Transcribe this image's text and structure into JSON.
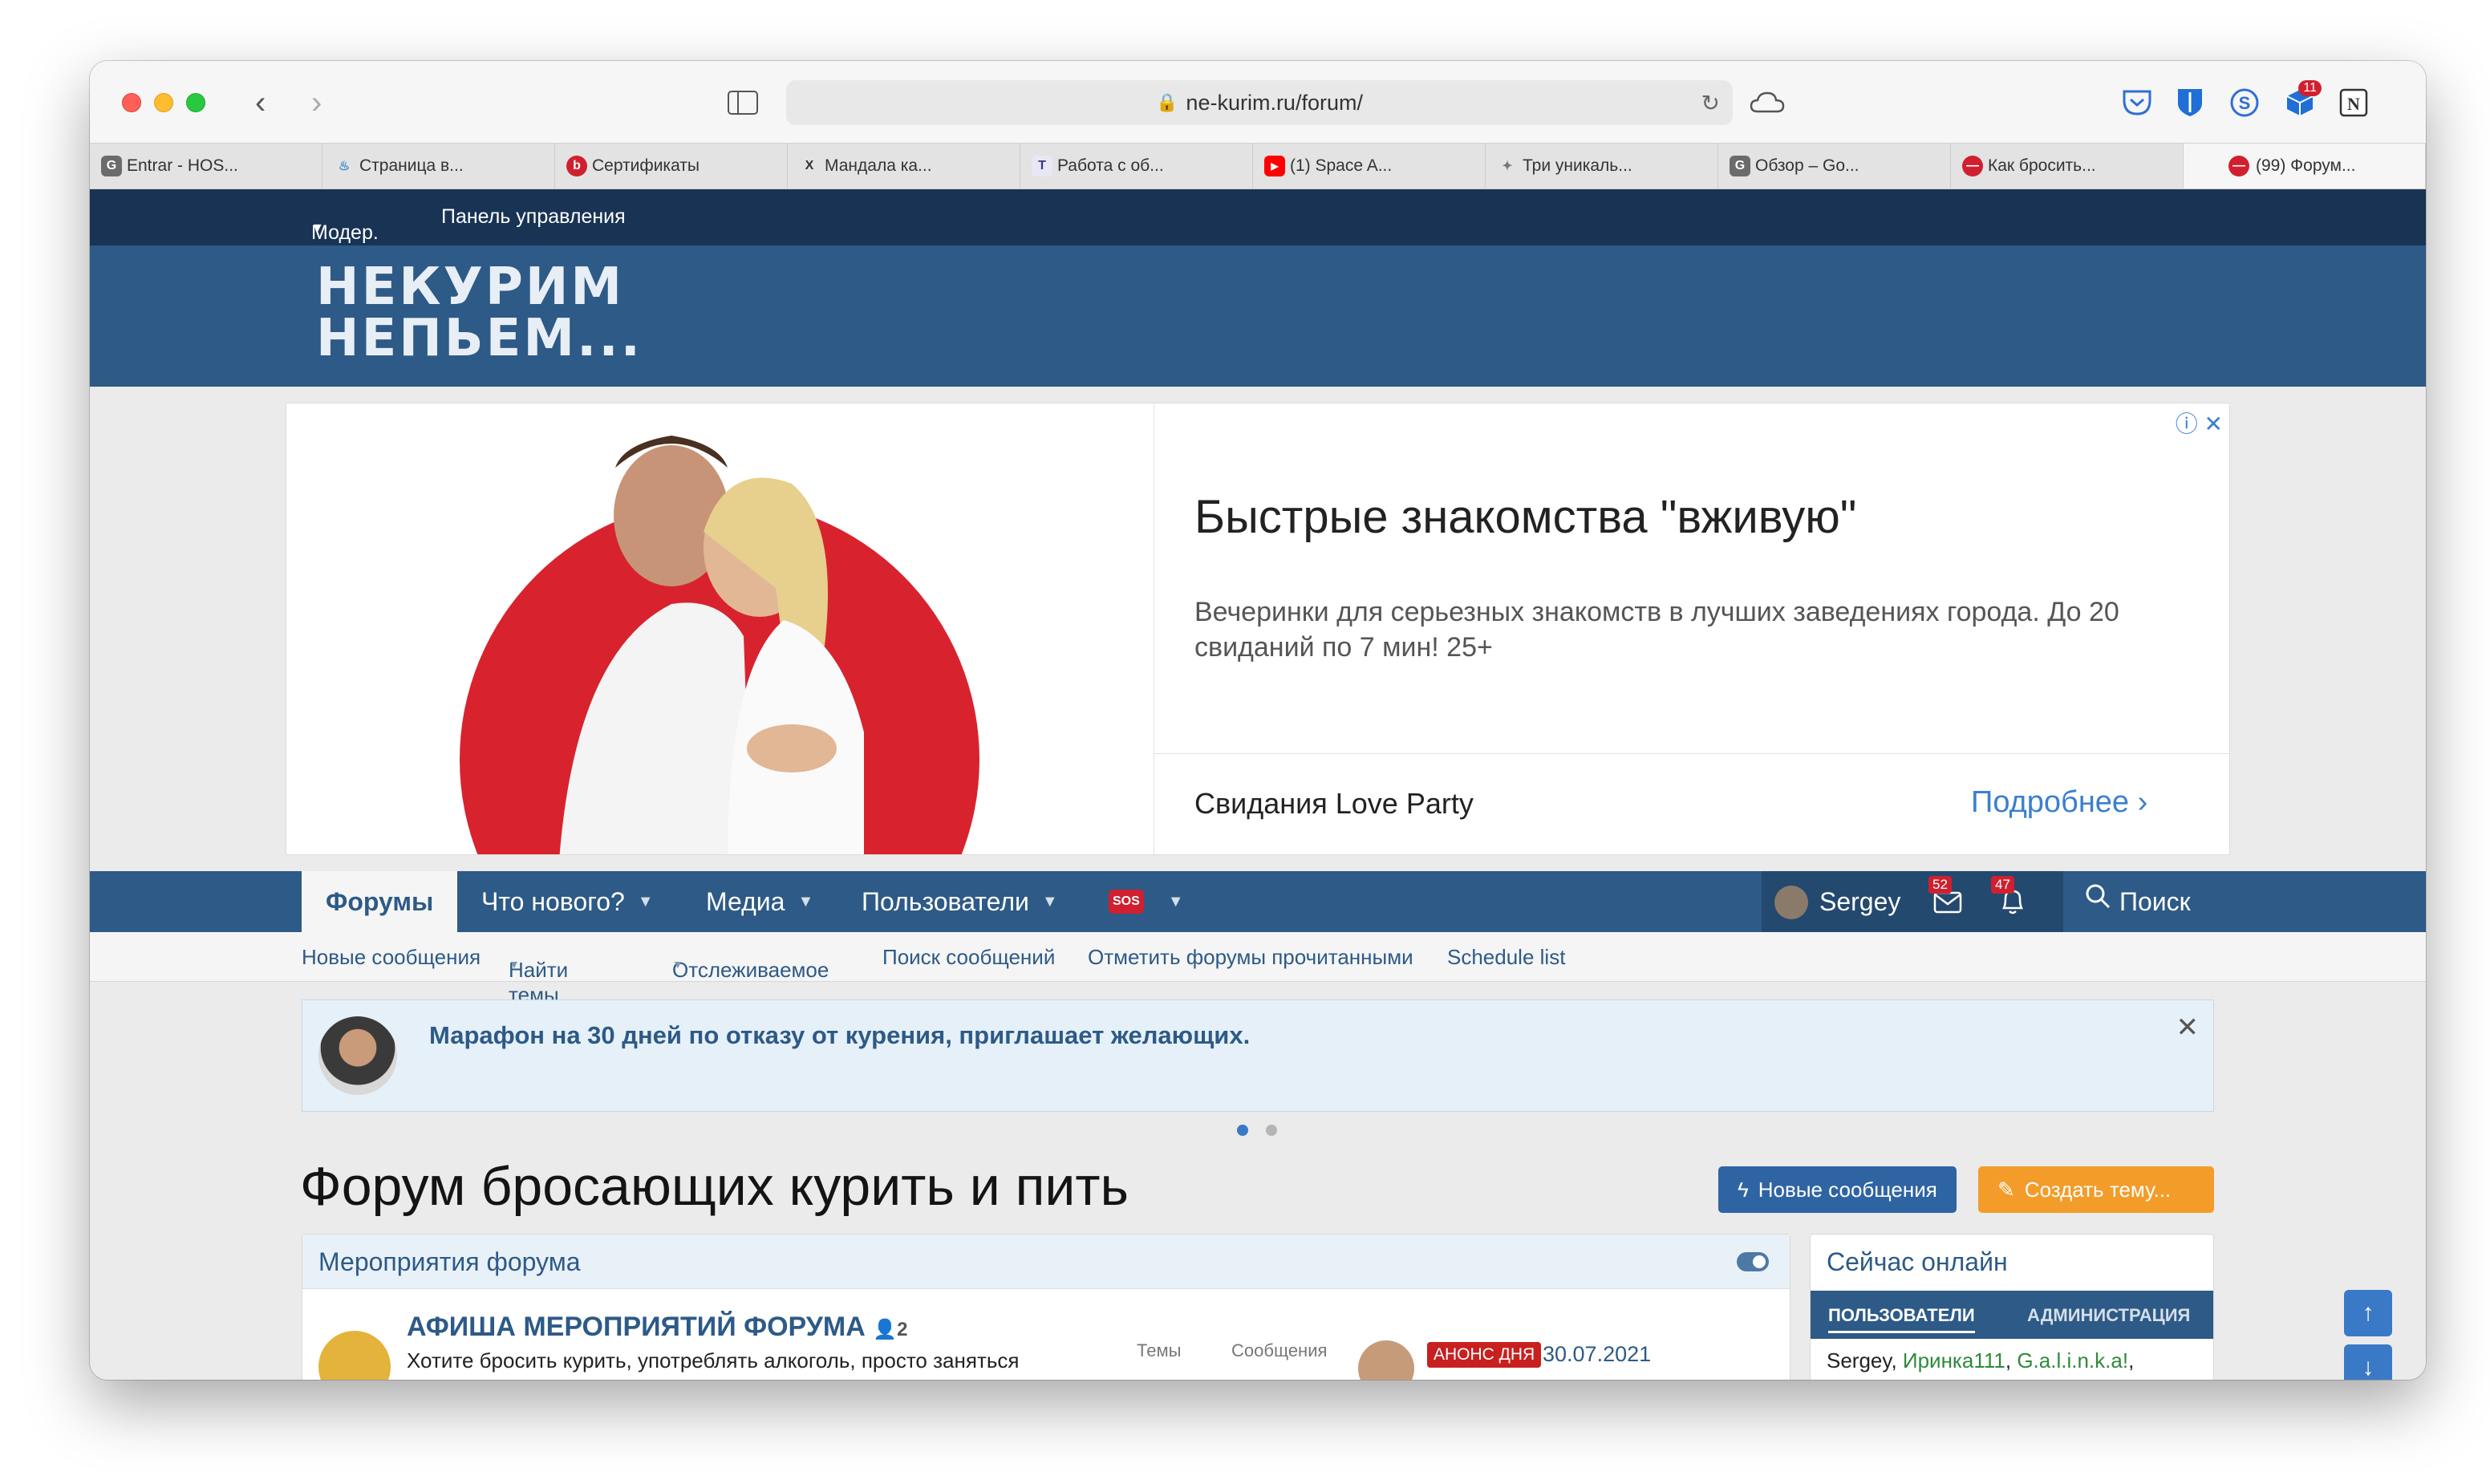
{
  "browser": {
    "url": "ne-kurim.ru/forum/",
    "tabs": [
      {
        "label": "Entrar - HOS...",
        "color": "#6b6b6b",
        "glyph": "G"
      },
      {
        "label": "Страница в...",
        "color": "#3a89c9",
        "glyph": "♨"
      },
      {
        "label": "Сертификаты",
        "color": "#d0202f",
        "glyph": "b"
      },
      {
        "label": "Мандала ка...",
        "color": "#333333",
        "glyph": "X"
      },
      {
        "label": "Работа с об...",
        "color": "#3a3a8a",
        "glyph": "T"
      },
      {
        "label": "(1) Space A...",
        "color": "#ff0000",
        "glyph": "▶"
      },
      {
        "label": "Три уникаль...",
        "color": "#777777",
        "glyph": "✦"
      },
      {
        "label": "Обзор – Go...",
        "color": "#6b6b6b",
        "glyph": "G"
      },
      {
        "label": "Как бросить...",
        "color": "#d0202f",
        "glyph": "—"
      },
      {
        "label": "(99) Форум...",
        "color": "#d0202f",
        "glyph": "—"
      }
    ],
    "ext_badge": "11"
  },
  "topnav": {
    "moder": "Модер.",
    "panel": "Панель управления"
  },
  "logo": {
    "line1": "НЕКУРИМ",
    "line2": "НЕПЬЕМ..."
  },
  "ad": {
    "title": "Быстрые знакомства \"вживую\"",
    "description": "Вечеринки для серьезных знакомств в лучших заведениях города. До 20 свиданий по 7 мин! 25+",
    "brand": "Свидания Love Party",
    "cta": "Подробнее"
  },
  "nav": {
    "forums": "Форумы",
    "whats_new": "Что нового?",
    "media": "Медиа",
    "users": "Пользователи",
    "sos": "SOS",
    "user": "Sergey",
    "messages_count": "52",
    "alerts_count": "47",
    "search": "Поиск"
  },
  "subnav": [
    "Новые сообщения",
    "Найти темы",
    "Отслеживаемое",
    "Поиск сообщений",
    "Отметить форумы прочитанными",
    "Schedule list"
  ],
  "notice": {
    "text": "Марафон на 30 дней по отказу от курения, приглашает желающих."
  },
  "page_title": "Форум бросающих курить и пить",
  "buttons": {
    "new_posts": "Новые сообщения",
    "create_thread": "Создать тему..."
  },
  "forum_block": {
    "title": "Мероприятия форума",
    "forum_name": "АФИША МЕРОПРИЯТИЙ ФОРУМА",
    "viewers": "2",
    "description": "Хотите бросить курить, употреблять алкоголь, просто заняться",
    "col_threads": "Темы",
    "col_messages": "Сообщения",
    "last_badge": "АНОНС ДНЯ",
    "last_date": "30.07.2021"
  },
  "online": {
    "title": "Сейчас онлайн",
    "tab_users": "ПОЛЬЗОВАТЕЛИ",
    "tab_admin": "АДМИНИСТРАЦИЯ",
    "users_prefix": "Sergey, ",
    "user2": "Иринка111",
    "user3": "G.a.l.i.n.k.a!"
  }
}
